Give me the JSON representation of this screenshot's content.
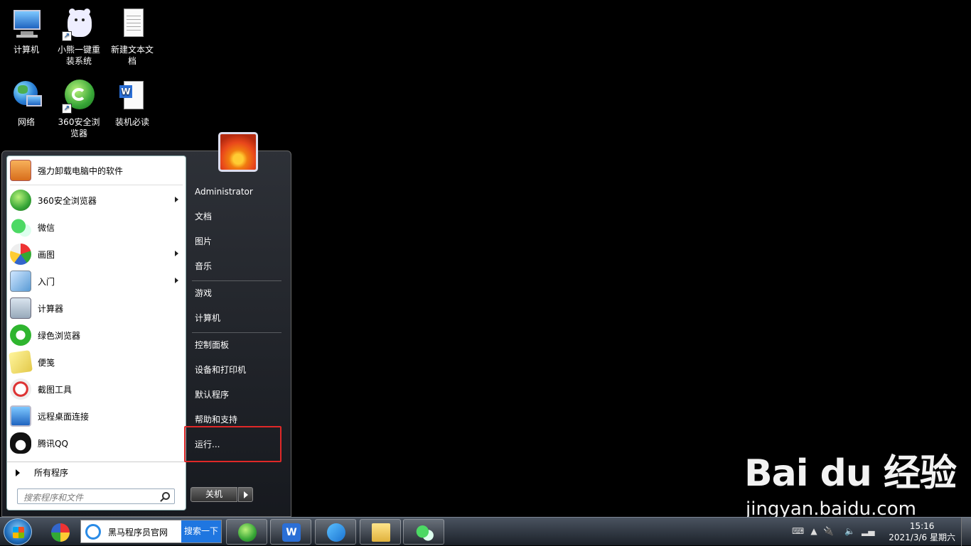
{
  "desktop": {
    "icons": [
      {
        "label": "计算机"
      },
      {
        "label": "小熊一键重装系统"
      },
      {
        "label": "新建文本文档"
      },
      {
        "label": "网络"
      },
      {
        "label": "360安全浏览器"
      },
      {
        "label": "装机必读"
      }
    ]
  },
  "start_menu": {
    "programs": [
      {
        "label": "强力卸载电脑中的软件",
        "icon": "uninstall-icon",
        "submenu": false
      },
      {
        "label": "360安全浏览器",
        "icon": "browser-360-icon",
        "submenu": true
      },
      {
        "label": "微信",
        "icon": "wechat-icon",
        "submenu": false
      },
      {
        "label": "画图",
        "icon": "paint-icon",
        "submenu": true
      },
      {
        "label": "入门",
        "icon": "getting-started-icon",
        "submenu": true
      },
      {
        "label": "计算器",
        "icon": "calculator-icon",
        "submenu": false
      },
      {
        "label": "绿色浏览器",
        "icon": "green-browser-icon",
        "submenu": false
      },
      {
        "label": "便笺",
        "icon": "sticky-notes-icon",
        "submenu": false
      },
      {
        "label": "截图工具",
        "icon": "snipping-tool-icon",
        "submenu": false
      },
      {
        "label": "远程桌面连接",
        "icon": "remote-desktop-icon",
        "submenu": false
      },
      {
        "label": "腾讯QQ",
        "icon": "qq-icon",
        "submenu": false
      }
    ],
    "all_programs": "所有程序",
    "search_placeholder": "搜索程序和文件",
    "right": {
      "user": "Administrator",
      "documents": "文档",
      "pictures": "图片",
      "music": "音乐",
      "games": "游戏",
      "computer": "计算机",
      "control_panel": "控制面板",
      "devices_printers": "设备和打印机",
      "default_programs": "默认程序",
      "help_support": "帮助和支持",
      "run": "运行..."
    },
    "shutdown": "关机"
  },
  "taskbar": {
    "ie_tab_title": "黑马程序员官网",
    "search_button": "搜索一下",
    "time": "15:16",
    "date": "2021/3/6 星期六"
  },
  "watermark": {
    "brand": "Bai du 经验",
    "url": "jingyan.baidu.com"
  },
  "colors": {
    "highlight_box": "#e02828",
    "taskbar": "#1b2129"
  }
}
